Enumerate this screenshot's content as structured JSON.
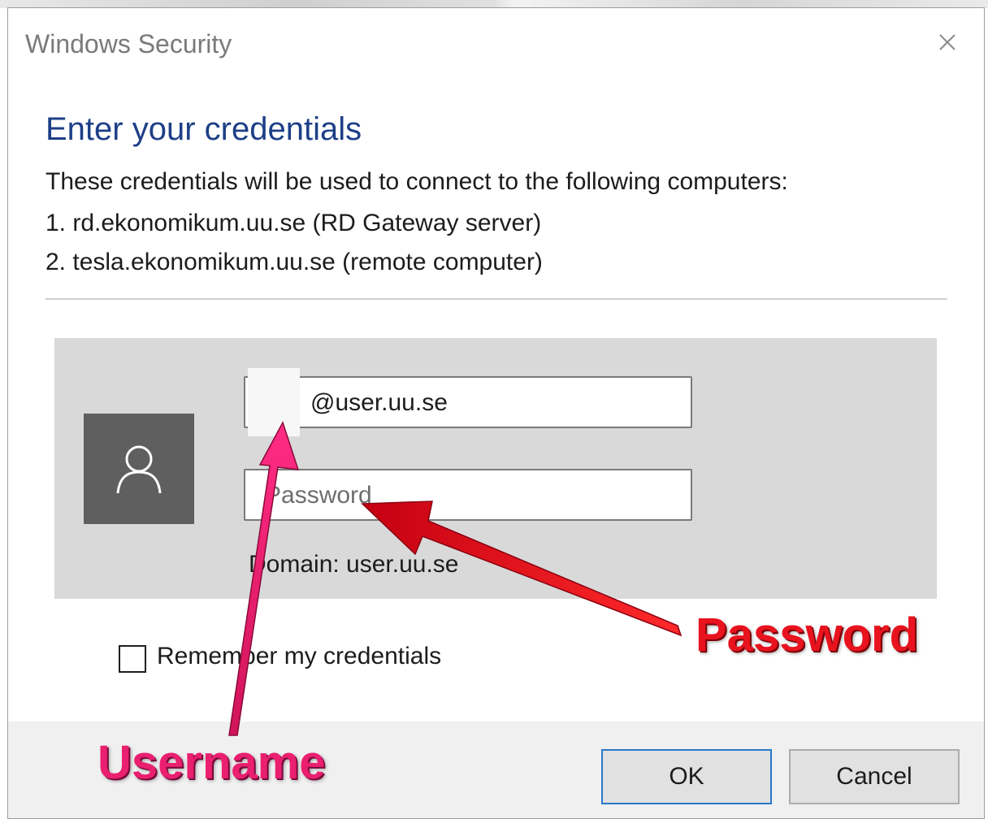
{
  "window": {
    "title": "Windows Security"
  },
  "dialog": {
    "heading": "Enter your credentials",
    "description": "These credentials will be used to connect to the following computers:",
    "computers": [
      "1. rd.ekonomikum.uu.se (RD Gateway server)",
      "2. tesla.ekonomikum.uu.se (remote computer)"
    ]
  },
  "credentials": {
    "username_value": "@user.uu.se",
    "password_placeholder": "Password",
    "domain_text": "Domain: user.uu.se",
    "remember_label": "Remember my credentials",
    "remember_checked": false
  },
  "buttons": {
    "ok": "OK",
    "cancel": "Cancel"
  },
  "annotations": {
    "password_label": "Password",
    "username_label": "Username",
    "password_color": "#e8131e",
    "username_color": "#ea1f70"
  },
  "icons": {
    "close": "close-icon",
    "avatar": "user-icon"
  }
}
